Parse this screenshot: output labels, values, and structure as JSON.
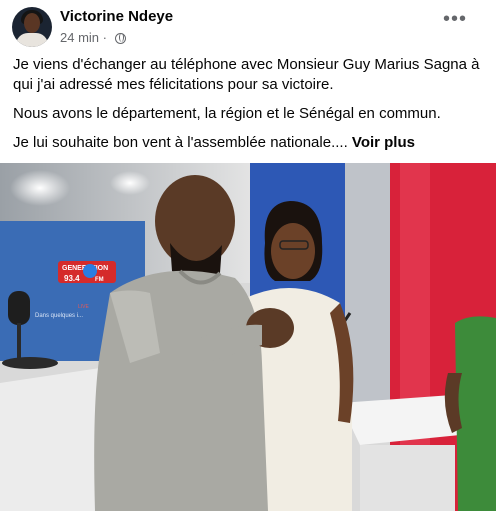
{
  "post": {
    "author": "Victorine Ndeye",
    "time": "24 min",
    "audience_icon": "globe-icon",
    "more_icon": "more-options-icon",
    "more_label": "•••",
    "paragraphs": [
      "Je viens d'échanger au téléphone avec Monsieur Guy Marius Sagna à qui j'ai adressé mes félicitations pour sa victoire.",
      "Nous avons le département, la région et le Sénégal en commun.",
      "Je lui souhaite bon vent à l'assemblée nationale...."
    ],
    "see_more": "Voir plus"
  },
  "photo": {
    "logo_top": "GENERATION",
    "logo_freq": "93.4",
    "logo_fm": "FM",
    "screen_line1": "LIVE",
    "screen_line2": "Dans quelques i..."
  }
}
